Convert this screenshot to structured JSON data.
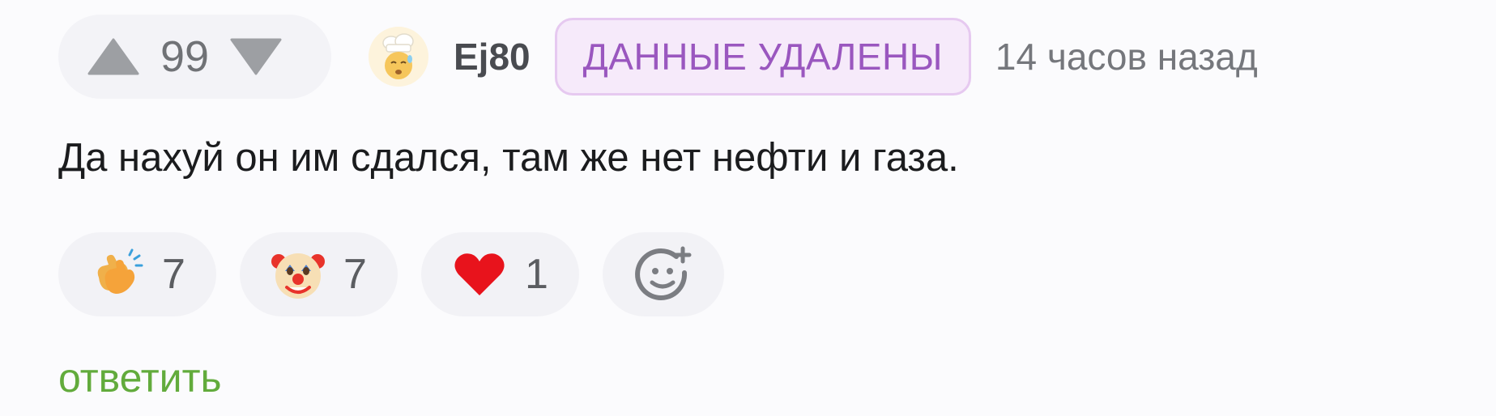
{
  "vote": {
    "count": "99",
    "up_icon": "triangle-up-icon",
    "down_icon": "triangle-down-icon"
  },
  "author": {
    "avatar_icon": "chef-avatar-icon",
    "username": "Ej80",
    "badge": "ДАННЫЕ УДАЛЕНЫ",
    "timestamp": "14 часов назад"
  },
  "comment": {
    "text": "Да нахуй он им сдался, там же нет нефти и газа."
  },
  "reactions": [
    {
      "icon": "clapping-hands-icon",
      "count": "7"
    },
    {
      "icon": "clown-face-icon",
      "count": "7"
    },
    {
      "icon": "red-heart-icon",
      "count": "1"
    }
  ],
  "add_reaction_icon": "add-emoji-icon",
  "reply_label": "ответить",
  "colors": {
    "badge_text": "#9a57bf",
    "badge_bg": "#f6eafa",
    "reply": "#62ab3c",
    "heart": "#e8131c"
  }
}
